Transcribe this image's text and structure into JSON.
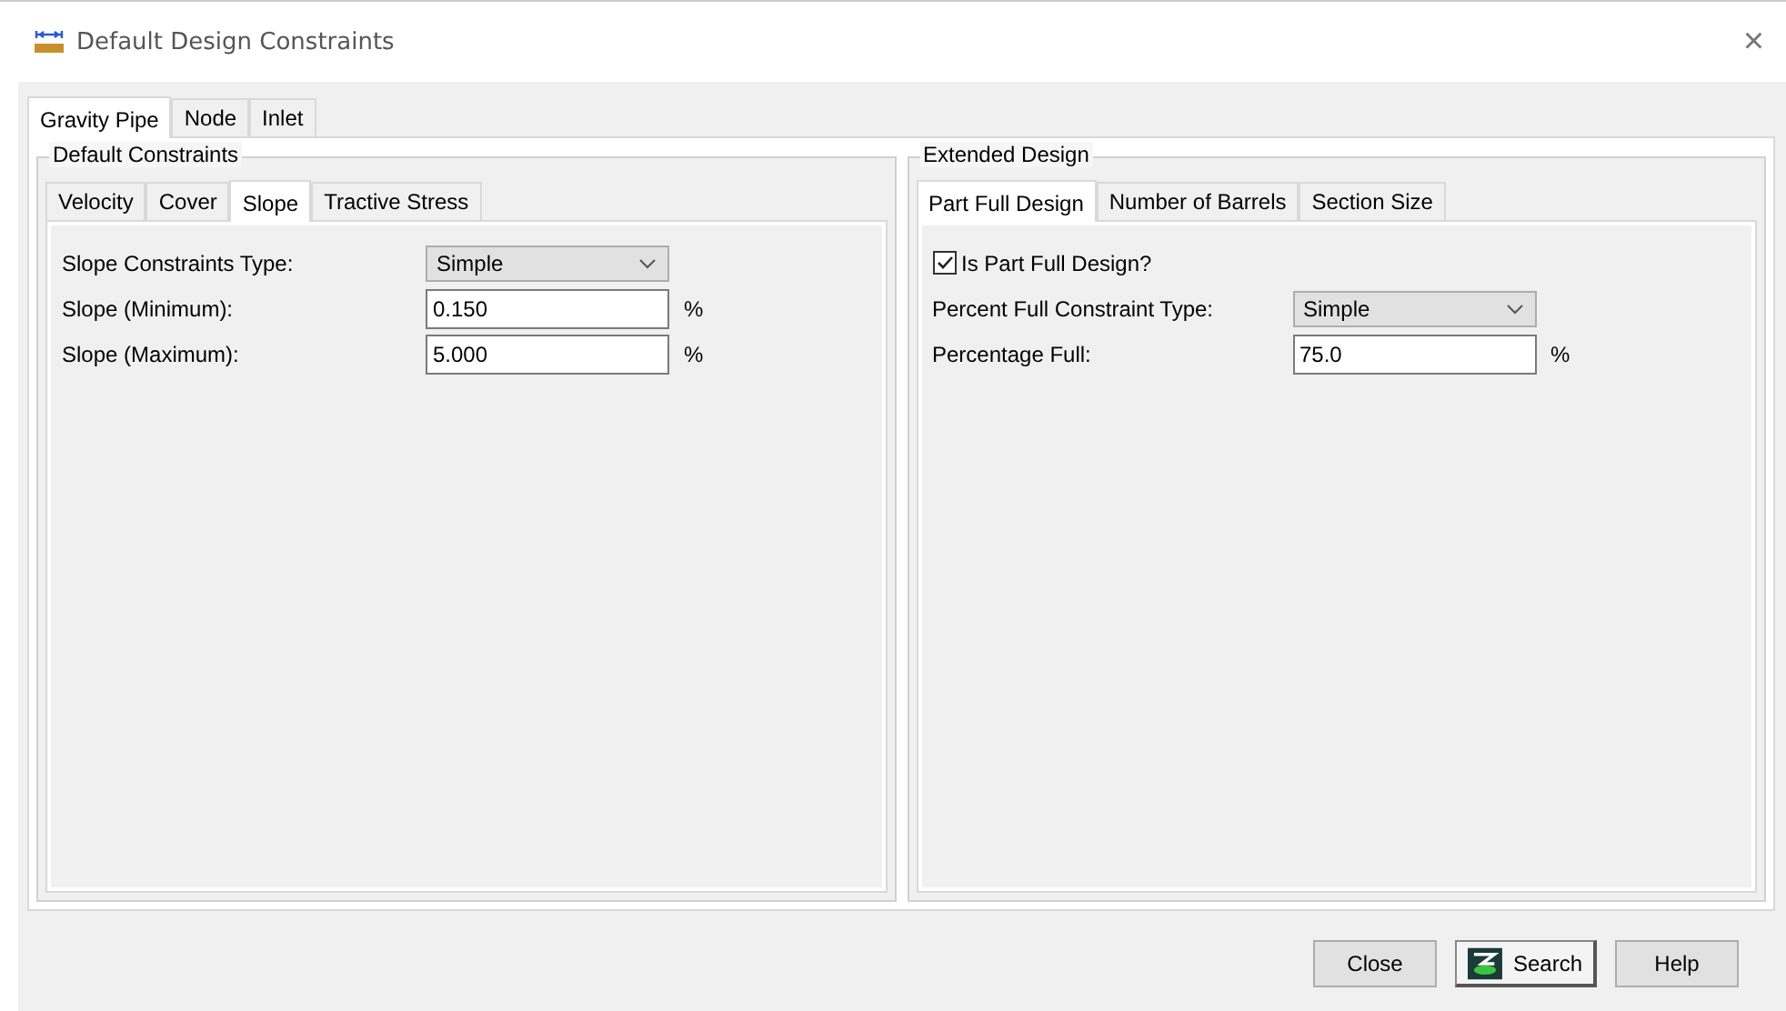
{
  "window": {
    "title": "Default Design Constraints",
    "close": "×"
  },
  "tabs": [
    {
      "label": "Gravity Pipe",
      "selected": true
    },
    {
      "label": "Node",
      "selected": false
    },
    {
      "label": "Inlet",
      "selected": false
    }
  ],
  "default_constraints": {
    "title": "Default Constraints",
    "tabs": [
      {
        "label": "Velocity",
        "selected": false
      },
      {
        "label": "Cover",
        "selected": false
      },
      {
        "label": "Slope",
        "selected": true
      },
      {
        "label": "Tractive Stress",
        "selected": false
      }
    ],
    "fields": [
      {
        "kind": "dropdown",
        "label": "Slope Constraints Type:",
        "value": "Simple"
      },
      {
        "kind": "input",
        "label": "Slope (Minimum):",
        "value": "0.150",
        "unit": "%"
      },
      {
        "kind": "input",
        "label": "Slope (Maximum):",
        "value": "5.000",
        "unit": "%"
      }
    ]
  },
  "extended_design": {
    "title": "Extended Design",
    "tabs": [
      {
        "label": "Part Full Design",
        "selected": true
      },
      {
        "label": "Number of Barrels",
        "selected": false
      },
      {
        "label": "Section Size",
        "selected": false
      }
    ],
    "fields": [
      {
        "kind": "checkbox",
        "label": "Is Part Full Design?",
        "checked": true
      },
      {
        "kind": "dropdown",
        "label": "Percent Full Constraint Type:",
        "value": "Simple"
      },
      {
        "kind": "input",
        "label": "Percentage Full:",
        "value": "75.0",
        "unit": "%"
      }
    ]
  },
  "buttons": [
    {
      "kind": "plain",
      "label": "Close"
    },
    {
      "kind": "icon",
      "label": "Search"
    },
    {
      "kind": "plain",
      "label": "Help"
    }
  ]
}
